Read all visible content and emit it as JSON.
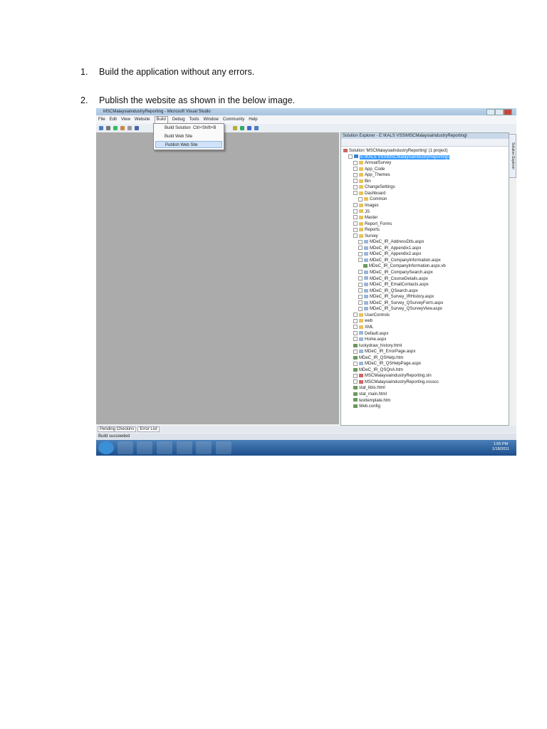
{
  "steps": [
    {
      "num": "1.",
      "text": "Build the application without any errors."
    },
    {
      "num": "2.",
      "text": "Publish the website as shown in the below image."
    }
  ],
  "window": {
    "title": "MSCMalaysiaIndustryReporting - Microsoft Visual Studio"
  },
  "menu": [
    "File",
    "Edit",
    "View",
    "Website",
    "Build",
    "Debug",
    "Tools",
    "Window",
    "Community",
    "Help"
  ],
  "build_menu": {
    "items": [
      {
        "label": "Build Solution",
        "shortcut": "Ctrl+Shift+B"
      },
      {
        "label": "Build Web Site",
        "shortcut": ""
      },
      {
        "label": "Publish Web Site",
        "shortcut": ""
      }
    ]
  },
  "solution_explorer": {
    "title": "Solution Explorer - E:\\KALS VSS\\MSCMalaysiaIndustryReporting\\",
    "side_tab": "Solution Explorer",
    "tree": [
      {
        "l": 0,
        "t": "Solution 'MSCMalaysiaIndustryReporting' (1 project)",
        "i": "sln"
      },
      {
        "l": 1,
        "t": "E:\\KALS VSS\\MSCMalaysiaIndustryReporting\\",
        "i": "web",
        "hl": true
      },
      {
        "l": 2,
        "t": "AnnualSurvey",
        "i": "folder"
      },
      {
        "l": 2,
        "t": "App_Code",
        "i": "folder"
      },
      {
        "l": 2,
        "t": "App_Themes",
        "i": "folder"
      },
      {
        "l": 2,
        "t": "Bin",
        "i": "folder"
      },
      {
        "l": 2,
        "t": "ChangeSettings",
        "i": "folder"
      },
      {
        "l": 2,
        "t": "Dashboard",
        "i": "folder"
      },
      {
        "l": 3,
        "t": "Common",
        "i": "folder"
      },
      {
        "l": 2,
        "t": "Images",
        "i": "folder"
      },
      {
        "l": 2,
        "t": "JS",
        "i": "folder"
      },
      {
        "l": 2,
        "t": "Master",
        "i": "folder"
      },
      {
        "l": 2,
        "t": "Report_Forms",
        "i": "folder"
      },
      {
        "l": 2,
        "t": "Reports",
        "i": "folder"
      },
      {
        "l": 2,
        "t": "Survey",
        "i": "folder"
      },
      {
        "l": 3,
        "t": "MDeC_IR_AddressDtls.aspx",
        "i": "page"
      },
      {
        "l": 3,
        "t": "MDeC_IR_Appendix1.aspx",
        "i": "page"
      },
      {
        "l": 3,
        "t": "MDeC_IR_Appendix2.aspx",
        "i": "page"
      },
      {
        "l": 3,
        "t": "MDeC_IR_CompanyInformation.aspx",
        "i": "page"
      },
      {
        "l": 4,
        "t": "MDeC_IR_CompanyInformation.aspx.vb",
        "i": "file"
      },
      {
        "l": 3,
        "t": "MDeC_IR_CompanySearch.aspx",
        "i": "page"
      },
      {
        "l": 3,
        "t": "MDeC_IR_CourseDetails.aspx",
        "i": "page"
      },
      {
        "l": 3,
        "t": "MDeC_IR_EmailContacts.aspx",
        "i": "page"
      },
      {
        "l": 3,
        "t": "MDeC_IR_QSearch.aspx",
        "i": "page"
      },
      {
        "l": 3,
        "t": "MDeC_IR_Survey_IRHistory.aspx",
        "i": "page"
      },
      {
        "l": 3,
        "t": "MDeC_IR_Survey_QSurveyForm.aspx",
        "i": "page"
      },
      {
        "l": 3,
        "t": "MDeC_IR_Survey_QSurveyView.aspx",
        "i": "page"
      },
      {
        "l": 2,
        "t": "UserControls",
        "i": "folder"
      },
      {
        "l": 2,
        "t": "web",
        "i": "folder"
      },
      {
        "l": 2,
        "t": "XML",
        "i": "folder"
      },
      {
        "l": 2,
        "t": "Default.aspx",
        "i": "page"
      },
      {
        "l": 2,
        "t": "Home.aspx",
        "i": "page"
      },
      {
        "l": 2,
        "t": "luckydraw_history.html",
        "i": "file"
      },
      {
        "l": 2,
        "t": "MDeC_IR_ErrorPage.aspx",
        "i": "page"
      },
      {
        "l": 2,
        "t": "MDeC_IR_QSHelp.htm",
        "i": "file"
      },
      {
        "l": 2,
        "t": "MDeC_IR_QSHelpPage.aspx",
        "i": "page"
      },
      {
        "l": 2,
        "t": "MDeC_IR_QSQnA.htm",
        "i": "file"
      },
      {
        "l": 2,
        "t": "MSCMalaysiaIndustryReporting.sln",
        "i": "sln"
      },
      {
        "l": 2,
        "t": "MSCMalaysiaIndustryReporting.vssscc",
        "i": "sln"
      },
      {
        "l": 2,
        "t": "stat_kbis.html",
        "i": "file"
      },
      {
        "l": 2,
        "t": "stat_main.html",
        "i": "file"
      },
      {
        "l": 2,
        "t": "testtemplate.htm",
        "i": "file"
      },
      {
        "l": 2,
        "t": "Web.config",
        "i": "file"
      }
    ]
  },
  "bottom_tabs": [
    "Pending Checkins",
    "Error List"
  ],
  "status": "Build succeeded",
  "clock": {
    "time": "1:55 PM",
    "date": "1/18/2011"
  }
}
